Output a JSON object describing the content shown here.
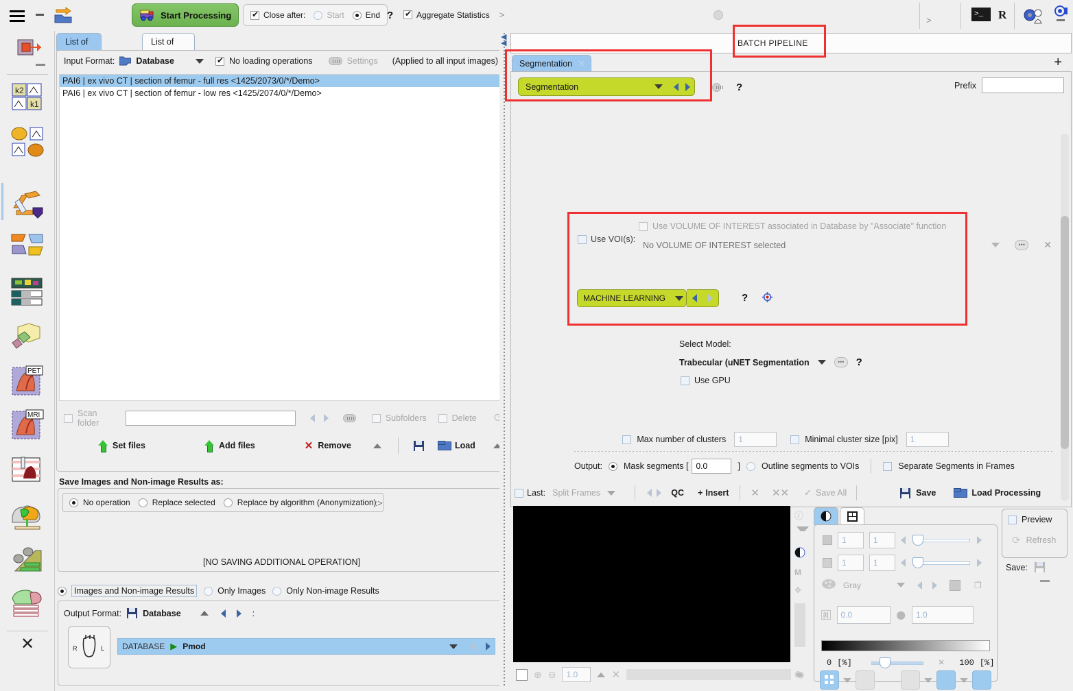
{
  "toolbar": {
    "start_processing": "Start Processing",
    "close_after": "Close after:",
    "start_option": "Start",
    "end_option": "End",
    "help": "?",
    "aggregate_statistics": "Aggregate Statistics",
    "chevron": ">",
    "terminal_label": ">_",
    "r_label": "R"
  },
  "left_panel": {
    "tabs": [
      {
        "label": "List of Input studies",
        "active": true
      },
      {
        "label": "List of Pipelines",
        "active": false
      }
    ],
    "input_format_label": "Input Format:",
    "input_format_value": "Database",
    "no_loading_operations": "No loading operations",
    "settings": "Settings",
    "applied_note": "(Applied to all input images)",
    "studies": [
      {
        "text": "PAI6 | ex vivo CT | section of femur - full res <1425/2073/0/*/Demo>",
        "selected": true
      },
      {
        "text": "PAI6 | ex vivo CT | section of femur - low res <1425/2074/0/*/Demo>",
        "selected": false
      }
    ],
    "scan_folder": "Scan folder",
    "scan_folder_value": "",
    "subfolders": "Subfolders",
    "delete": "Delete",
    "set_files": "Set files",
    "add_files": "Add files",
    "remove": "Remove",
    "load": "Load",
    "save_as_label": "Save Images and Non-image Results  as:",
    "save_options": [
      "No operation",
      "Replace selected",
      "Replace by algorithm (Anonymization)"
    ],
    "save_selected_index": 0,
    "save_arrow": ":>",
    "no_saving_message": "[NO SAVING ADDITIONAL OPERATION]",
    "result_types": [
      "Images and Non-image Results",
      "Only Images",
      "Only Non-image Results"
    ],
    "result_selected_index": 0,
    "output_format_label": "Output Format:",
    "output_format_value": "Database",
    "output_format_colon": ":",
    "database_label": "DATABASE",
    "database_value": "Pmod"
  },
  "right_panel": {
    "batch_pipeline_title": "BATCH PIPELINE",
    "pipeline_tab": "Segmentation",
    "pipeline_tab_close": "✕",
    "add_tab": "+",
    "operation": "Segmentation",
    "help": "?",
    "prefix_label": "Prefix",
    "prefix_value": "",
    "use_voi_label": "Use VOI(s):",
    "associate_label": "Use VOLUME OF INTEREST associated in Database by \"Associate\" function",
    "voi_selection": "No VOLUME OF INTEREST selected",
    "ml_operation": "MACHINE LEARNING",
    "ml_help": "?",
    "select_model_label": "Select Model:",
    "model_value": "Trabecular (uNET Segmentation",
    "model_help": "?",
    "use_gpu": "Use GPU",
    "max_clusters_label": "Max number of clusters",
    "max_clusters_value": "1",
    "min_cluster_label": "Minimal cluster size [pix]",
    "min_cluster_value": "1",
    "output_label": "Output:",
    "mask_segments_label": "Mask segments [",
    "mask_segments_value": "0.0",
    "mask_segments_close": "]",
    "outline_segments_label": "Outline segments to VOIs",
    "separate_segments_label": "Separate Segments in Frames"
  },
  "bottom_bar": {
    "last_label": "Last:",
    "split_frames": "Split Frames",
    "qc": "QC",
    "insert": "Insert",
    "insert_plus": "+",
    "save_all": "Save All",
    "save_all_check": "✓",
    "close_x": "✕",
    "close_all_x": "✕✕",
    "save": "Save",
    "load_processing": "Load Processing"
  },
  "viewer": {
    "zoom_value": "1.0"
  },
  "control_panel": {
    "slice_from": "1",
    "slice_to": "1",
    "frame_from": "1",
    "frame_to": "1",
    "colortable": "Gray",
    "min_value": "0.0",
    "max_value": "1.0",
    "percent_min": "0",
    "percent_min_unit": "[%]",
    "percent_max": "100",
    "percent_max_unit": "[%]"
  },
  "preview": {
    "preview_label": "Preview",
    "refresh_label": "Refresh",
    "save_label": "Save:"
  },
  "colors": {
    "accent_green": "#6cb250",
    "operation_green": "#c5d92b",
    "selection_blue": "#9dcbf0",
    "annotation_red": "#f03030",
    "panel_bg": "#efefef"
  }
}
